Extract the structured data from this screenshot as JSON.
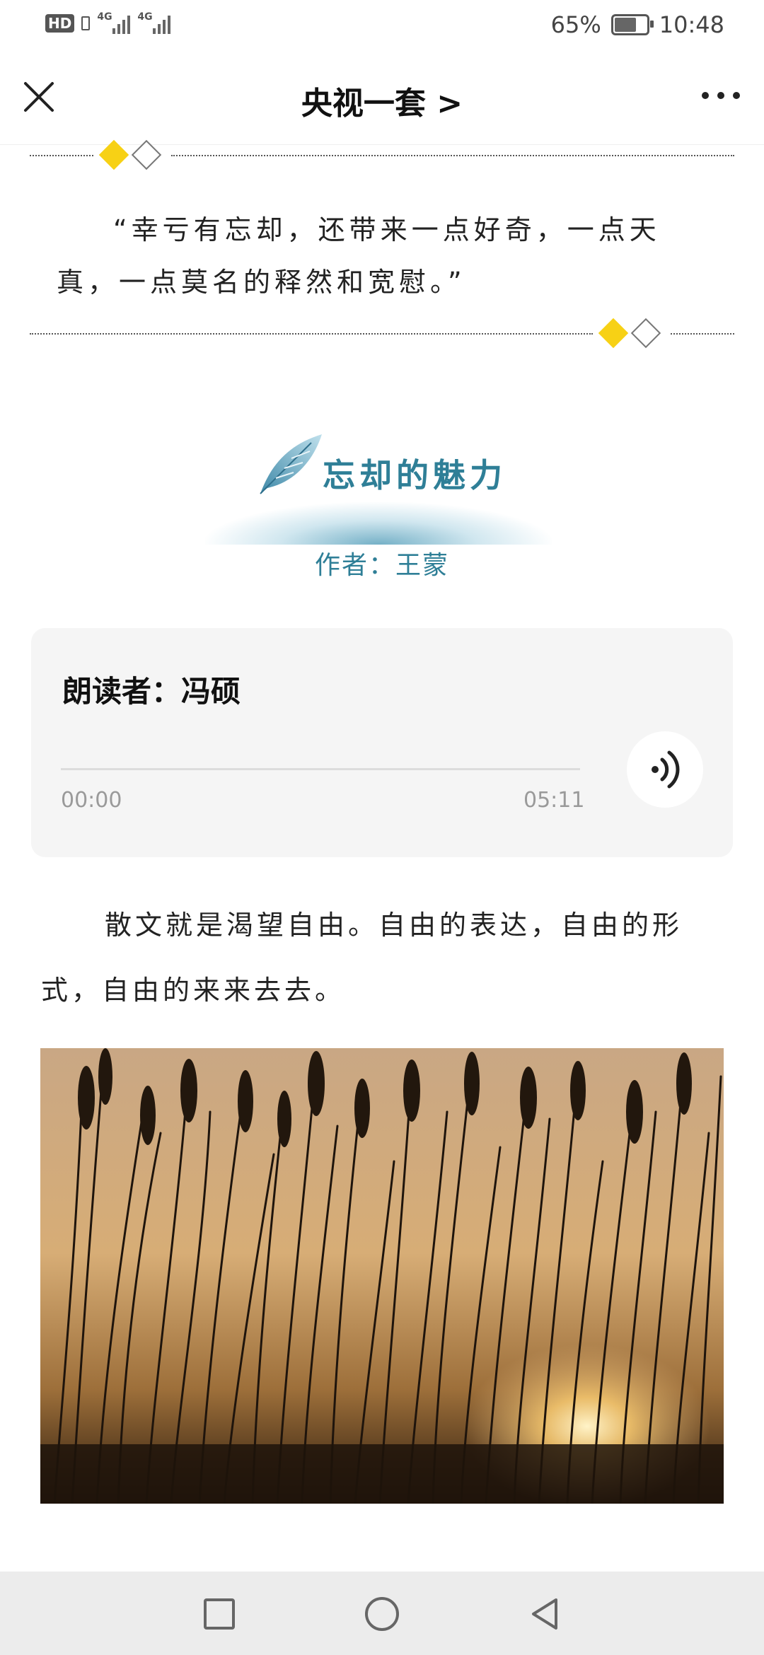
{
  "status_bar": {
    "hd_label": "HD",
    "network_1": "4G",
    "network_2": "4G",
    "battery_percent": "65%",
    "time": "10:48"
  },
  "nav": {
    "title": "央视一套 >",
    "close_icon": "close-icon",
    "more_icon": "more-icon"
  },
  "quote": {
    "text": "“幸亏有忘却，还带来一点好奇，一点天真，一点莫名的释然和宽慰。”"
  },
  "article": {
    "title": "忘却的魅力",
    "author": "作者：王蒙"
  },
  "audio": {
    "reader": "朗读者：冯硕",
    "current_time": "00:00",
    "duration": "05:11",
    "progress": 0,
    "play_icon": "audio-wave-icon"
  },
  "body": {
    "paragraph_1": "散文就是渴望自由。自由的表达，自由的形式，自由的来来去去。"
  },
  "colors": {
    "accent": "#2f7f97",
    "diamond_yellow": "#f7d115",
    "card_bg": "#f5f5f5"
  },
  "bottom_nav": {
    "recent_icon": "square-icon",
    "home_icon": "circle-icon",
    "back_icon": "triangle-back-icon"
  }
}
